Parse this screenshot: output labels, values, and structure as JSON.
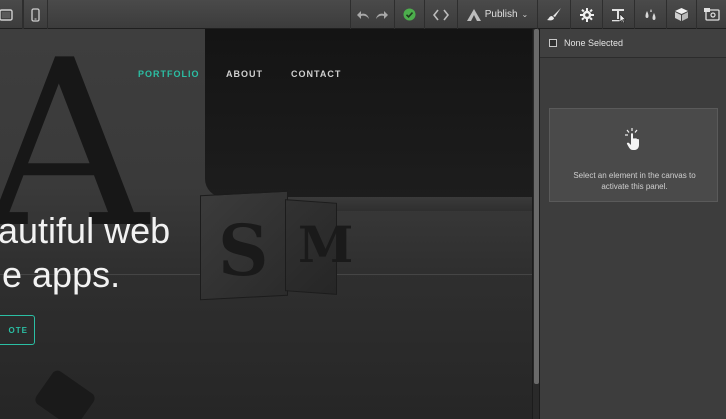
{
  "toolbar": {
    "publish_label": "Publish",
    "publish_chevron": "⌄",
    "icons": [
      "tablet-icon",
      "phone-icon",
      "undo-icon",
      "redo-icon",
      "check-circle-icon",
      "code-icon",
      "publish-icon",
      "brush-icon",
      "gear-icon",
      "text-style-icon",
      "droplets-icon",
      "cube-icon",
      "settings-panel-icon"
    ],
    "accent": "#4cae4c"
  },
  "canvas": {
    "nav": {
      "items": [
        "PORTFOLIO",
        "ABOUT",
        "CONTACT"
      ],
      "active": "PORTFOLIO",
      "accent": "#2bbfa4"
    },
    "hero_line_1": "autiful web",
    "hero_line_2": "le apps.",
    "cta_label": "OTE"
  },
  "panel": {
    "title": "None Selected",
    "empty_message": "Select an element in the canvas to activate this panel.",
    "icon": "pointer-hand-icon"
  }
}
